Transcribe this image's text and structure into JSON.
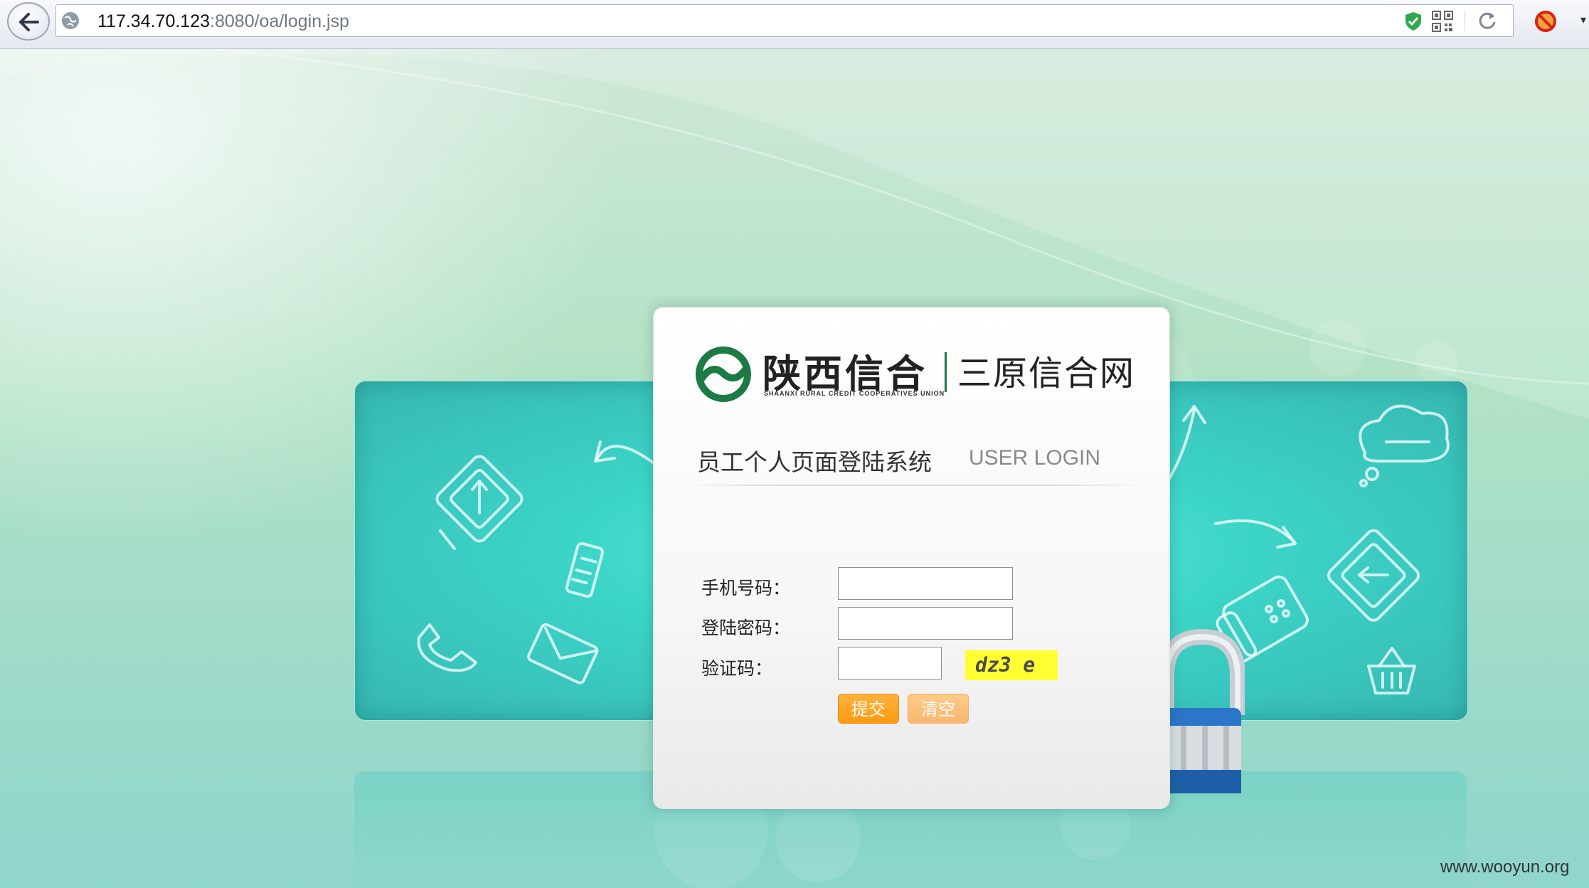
{
  "browser": {
    "url_host": "117.34.70.123",
    "url_path": ":8080/oa/login.jsp"
  },
  "logo": {
    "name_cn": "陕西信合",
    "name_en": "SHAANXI RURAL CREDIT COOPERATIVES UNION"
  },
  "site_name": "三原信合网",
  "title_cn": "员工个人页面登陆系统",
  "title_en": "USER LOGIN",
  "form": {
    "phone_label": "手机号码：",
    "phone_value": "",
    "password_label": "登陆密码：",
    "password_value": "",
    "captcha_label": "验证码：",
    "captcha_value": "",
    "captcha_image_text": "dz3 e",
    "submit_label": "提交",
    "clear_label": "清空"
  },
  "watermark": "www.wooyun.org",
  "colors": {
    "brand_green": "#1c7a45",
    "submit_orange": "#ff9e1b",
    "clear_orange": "#f9bd78",
    "captcha_yellow": "#ffff33",
    "banner_teal": "#3cd3c7"
  }
}
